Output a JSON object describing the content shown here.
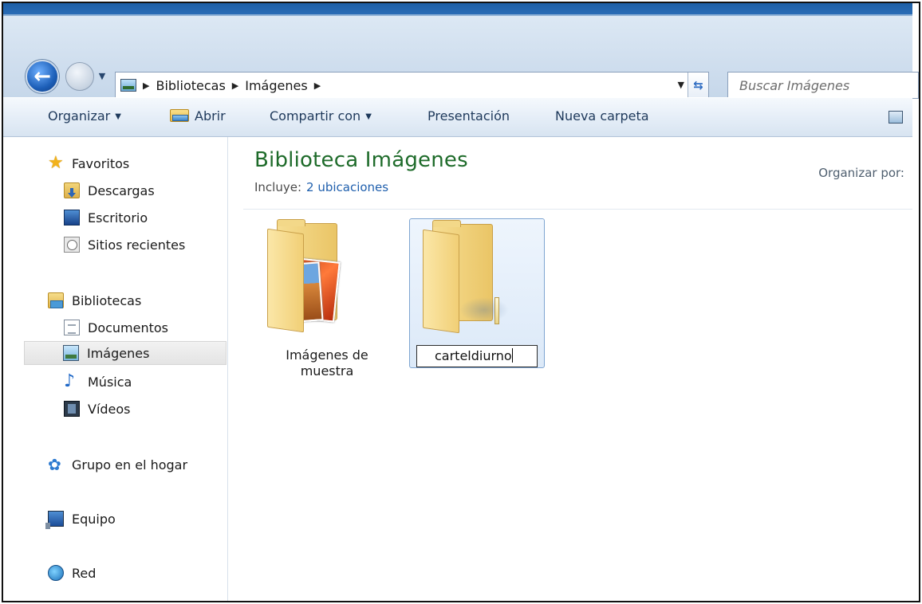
{
  "address": {
    "crumbs": [
      "Bibliotecas",
      "Imágenes"
    ]
  },
  "search": {
    "placeholder": "Buscar Imágenes"
  },
  "toolbar": {
    "organize": "Organizar",
    "open": "Abrir",
    "share": "Compartir con",
    "slideshow": "Presentación",
    "new_folder": "Nueva carpeta"
  },
  "sidebar": {
    "favorites": "Favoritos",
    "downloads": "Descargas",
    "desktop": "Escritorio",
    "recent": "Sitios recientes",
    "libraries": "Bibliotecas",
    "documents": "Documentos",
    "images": "Imágenes",
    "music": "Música",
    "videos": "Vídeos",
    "homegroup": "Grupo en el hogar",
    "computer": "Equipo",
    "network": "Red"
  },
  "content": {
    "title": "Biblioteca Imágenes",
    "includes_label": "Incluye:",
    "includes_link": "2 ubicaciones",
    "arrange_by": "Organizar por:",
    "items": [
      {
        "label": "Imágenes de muestra"
      },
      {
        "rename_value": "carteldiurno"
      }
    ]
  },
  "colors": {
    "title_green": "#1e6b2a",
    "link_blue": "#1f5fad",
    "selection_border": "#7ea5d1"
  },
  "icons": {
    "back": "back-arrow-icon",
    "forward": "forward-arrow-icon",
    "refresh": "refresh-icon"
  }
}
